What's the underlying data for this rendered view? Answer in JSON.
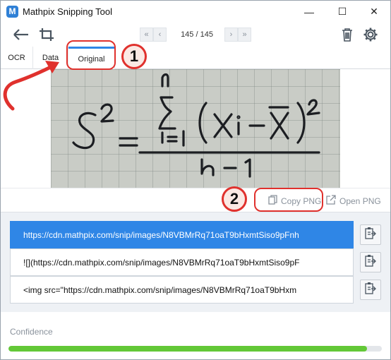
{
  "app": {
    "title": "Mathpix Snipping Tool",
    "icon_letter": "M",
    "accent_color": "#2f86e6"
  },
  "window_controls": {
    "minimize": "—",
    "maximize": "☐",
    "close": "✕"
  },
  "toolbar": {
    "page_counter": "145 / 145",
    "icons": [
      "back-arrow-icon",
      "screen-snip-icon",
      "first-page-icon",
      "previous-page-icon",
      "next-page-icon",
      "last-page-icon",
      "trash-icon",
      "gear-icon"
    ]
  },
  "tabs": [
    {
      "label": "OCR"
    },
    {
      "label": "Data"
    },
    {
      "label": "Original",
      "active": true
    }
  ],
  "copy_actions": {
    "copy_png": "Copy PNG",
    "open_png": "Open PNG"
  },
  "links": [
    {
      "text": "https://cdn.mathpix.com/snip/images/N8VBMrRq71oaT9bHxmtSiso9pFnh",
      "selected": true
    },
    {
      "text": "![](https://cdn.mathpix.com/snip/images/N8VBMrRq71oaT9bHxmtSiso9pF"
    },
    {
      "text": "<img src=\"https://cdn.mathpix.com/snip/images/N8VBMrRq71oaT9bHxm"
    }
  ],
  "confidence": {
    "label": "Confidence",
    "level": 0.96,
    "color": "#63c837"
  },
  "annotations": [
    {
      "number": "1",
      "target": "tab-original"
    },
    {
      "number": "2",
      "target": "copy-png-button"
    }
  ],
  "colors": {
    "annotation_red": "#e0312d"
  }
}
